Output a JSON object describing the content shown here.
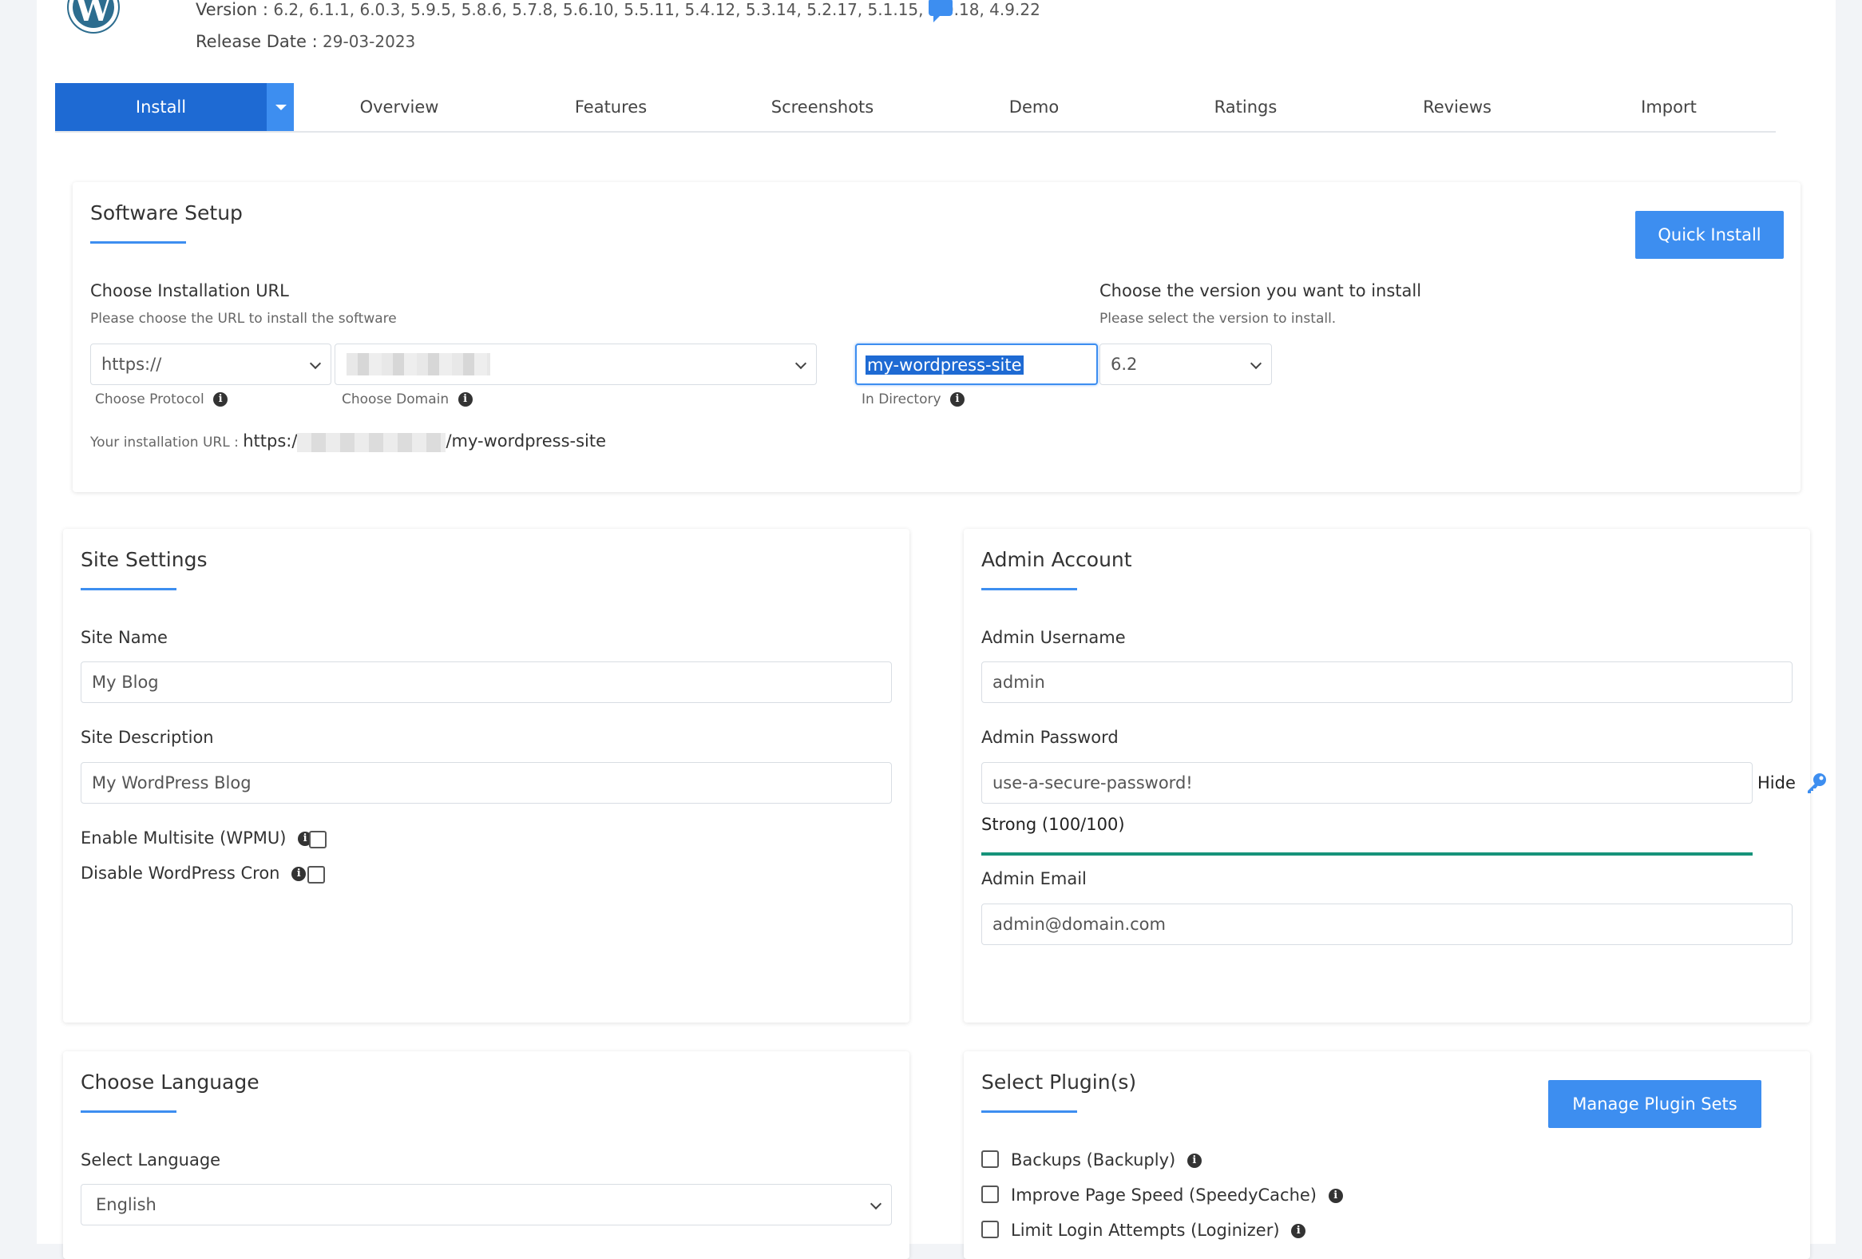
{
  "header": {
    "version_label": "Version :",
    "versions": "6.2, 6.1.1, 6.0.3, 5.9.5, 5.8.6, 5.7.8, 5.6.10, 5.5.11, 5.4.12, 5.3.14, 5.2.17, 5.1.15, 5.0.18, 4.9.22",
    "release_label": "Release Date :",
    "release_date": "29-03-2023",
    "logo_letter": "W"
  },
  "tabs": {
    "install": "Install",
    "items": [
      "Overview",
      "Features",
      "Screenshots",
      "Demo",
      "Ratings",
      "Reviews",
      "Import"
    ]
  },
  "software_setup": {
    "title": "Software Setup",
    "quick_install": "Quick Install",
    "url_label": "Choose Installation URL",
    "url_hint": "Please choose the URL to install the software",
    "protocol_value": "https://",
    "protocol_caption": "Choose Protocol",
    "domain_caption": "Choose Domain",
    "directory_value": "my-wordpress-site",
    "directory_caption": "In Directory",
    "install_url_label": "Your installation URL :",
    "install_url_prefix": "https:/",
    "install_url_suffix": "/my-wordpress-site",
    "version_label": "Choose the version you want to install",
    "version_hint": "Please select the version to install.",
    "version_value": "6.2"
  },
  "site_settings": {
    "title": "Site Settings",
    "site_name_label": "Site Name",
    "site_name_value": "My Blog",
    "site_desc_label": "Site Description",
    "site_desc_value": "My WordPress Blog",
    "multisite_label": "Enable Multisite (WPMU)",
    "cron_label": "Disable WordPress Cron"
  },
  "admin_account": {
    "title": "Admin Account",
    "username_label": "Admin Username",
    "username_value": "admin",
    "password_label": "Admin Password",
    "password_value": "use-a-secure-password!",
    "hide_label": "Hide",
    "strength_label": "Strong (100/100)",
    "strength_fraction": 1.0,
    "email_label": "Admin Email",
    "email_value": "admin@domain.com"
  },
  "language": {
    "title": "Choose Language",
    "select_label": "Select Language",
    "value": "English"
  },
  "plugins": {
    "title": "Select Plugin(s)",
    "manage_button": "Manage Plugin Sets",
    "items": [
      "Backups (Backuply)",
      "Improve Page Speed (SpeedyCache)",
      "Limit Login Attempts (Loginizer)"
    ]
  },
  "colors": {
    "primary": "#1e6ad3",
    "accent": "#3d8ef0",
    "strength": "#16937a"
  }
}
